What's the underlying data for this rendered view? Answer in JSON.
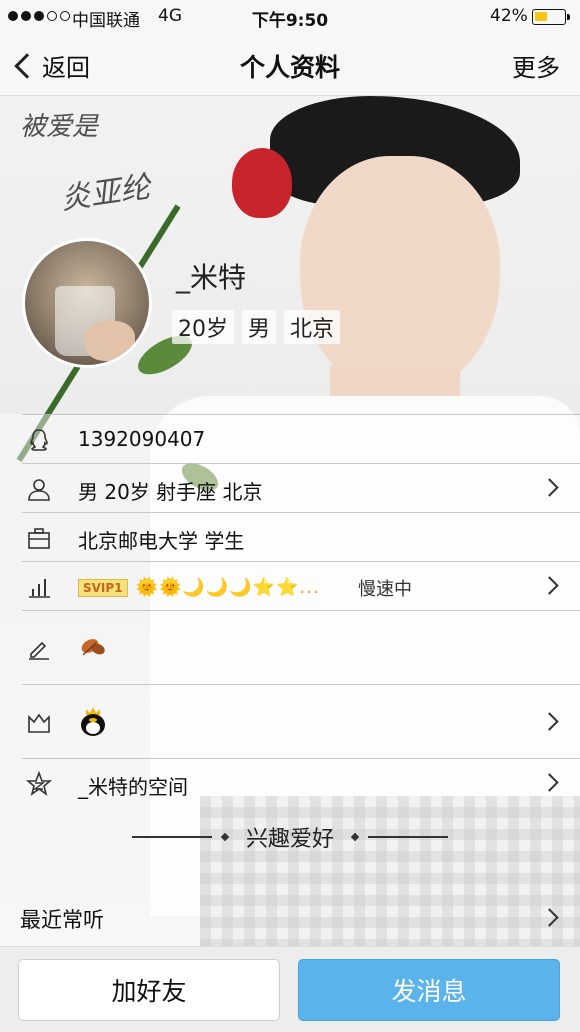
{
  "status_bar": {
    "carrier": "中国联通",
    "network": "4G",
    "time": "下午9:50",
    "battery_percent": "42%",
    "battery_level": 0.42,
    "signal_bars_filled": 3,
    "signal_bars_total": 5
  },
  "nav": {
    "back_label": "返回",
    "title": "个人资料",
    "more_label": "更多"
  },
  "profile": {
    "nickname": "_米特",
    "age": "20岁",
    "gender": "男",
    "city": "北京"
  },
  "details": {
    "qq_number": "1392090407",
    "basic_info": "男 20岁 射手座 北京",
    "school": "北京邮电大学 学生",
    "svip_badge": "SVIP1",
    "level_icons": "🌞🌞🌙🌙🌙⭐⭐...",
    "level_speed": "慢速中",
    "space_label": "_米特的空间"
  },
  "icons": {
    "qq": "qq-penguin-icon",
    "person": "person-icon",
    "briefcase": "briefcase-icon",
    "level": "level-chart-icon",
    "pen": "pen-icon",
    "crown": "crown-icon",
    "star": "star-icon",
    "leaf": "autumn-leaf-icon",
    "penguin": "penguin-crown-icon"
  },
  "section": {
    "interests_title": "兴趣爱好",
    "recent_listening": "最近常听"
  },
  "actions": {
    "add_friend": "加好友",
    "send_message": "发消息"
  },
  "colors": {
    "send_button": "#5ab3ea",
    "battery_fill": "#f5c518",
    "svip_badge_bg": "#f6e27a"
  }
}
